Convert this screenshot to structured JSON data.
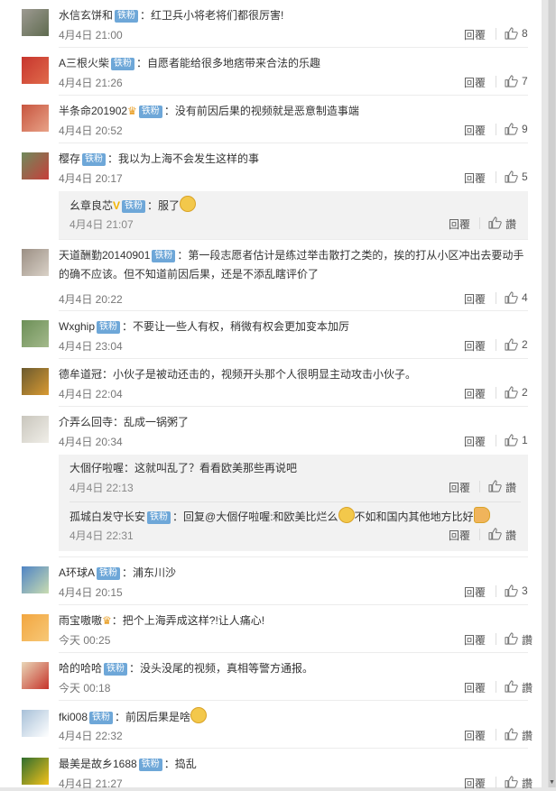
{
  "reply_label": "回覆",
  "like_placeholder": "讚",
  "badge_label": "铁粉",
  "colors": {
    "badge": "#6ea7d8",
    "page_bg": "#ffffff",
    "sub_bg": "#f2f2f2",
    "text": "#333333",
    "meta": "#777777"
  },
  "comments": [
    {
      "user": "水信玄饼和",
      "badge": true,
      "text": "：红卫兵小将老将们都很厉害!",
      "time": "4月4日 21:00",
      "likes": "8"
    },
    {
      "user": "A三根火柴",
      "badge": true,
      "text": "：自愿者能给很多地痞带来合法的乐趣",
      "time": "4月4日 21:26",
      "likes": "7"
    },
    {
      "user": "半条命201902",
      "crown": true,
      "badge": true,
      "text": "：没有前因后果的视频就是恶意制造事端",
      "time": "4月4日 20:52",
      "likes": "9"
    },
    {
      "user": "樱存",
      "badge": true,
      "text": "：我以为上海不会发生这样的事",
      "time": "4月4日 20:17",
      "likes": "5",
      "replies": [
        {
          "user": "幺章良芯",
          "verified": true,
          "badge": true,
          "text": "：服了",
          "emoji": true,
          "time": "4月4日 21:07"
        }
      ]
    },
    {
      "user": "天道酬勤20140901",
      "badge": true,
      "text": "：第一段志愿者估计是练过举击散打之类的，挨的打从小区冲出去要动手的确不应该。但不知道前因后果，还是不添乱瞎评价了",
      "time": "4月4日 20:22",
      "likes": "4"
    },
    {
      "user": "Wxghip",
      "badge": true,
      "text": "：不要让一些人有权，稍微有权会更加变本加厉",
      "time": "4月4日 23:04",
      "likes": "2"
    },
    {
      "user": "德牟道冠",
      "text": "：小伙子是被动还击的，视频开头那个人很明显主动攻击小伙子。",
      "time": "4月4日 22:04",
      "likes": "2"
    },
    {
      "user": "介弄么回寺",
      "text": "：乱成一锅粥了",
      "time": "4月4日 20:34",
      "likes": "1",
      "replies": [
        {
          "user": "大個仔啦喔",
          "text": "：这就叫乱了？看看欧美那些再说吧",
          "time": "4月4日 22:13"
        },
        {
          "user": "孤城白发守长安",
          "badge": true,
          "text": "：回复@大個仔啦喔:和欧美比烂么",
          "emoji": true,
          "text2": "不如和国内其他地方比好",
          "emoji2": true,
          "time": "4月4日 22:31"
        }
      ]
    },
    {
      "user": "A环球A",
      "badge": true,
      "text": "：浦东川沙",
      "time": "4月4日 20:15",
      "likes": "3"
    },
    {
      "user": "雨宝嗷嗷",
      "crown": true,
      "text": "：把个上海弄成这样?!让人痛心!",
      "time": "今天 00:25",
      "likes": "讚"
    },
    {
      "user": "哈的哈哈",
      "badge": true,
      "text": "：没头没尾的视频，真相等警方通报。",
      "time": "今天 00:18",
      "likes": "讚"
    },
    {
      "user": "fki008",
      "badge": true,
      "text": "：前因后果是啥",
      "emoji": true,
      "time": "4月4日 22:32",
      "likes": "讚"
    },
    {
      "user": "最美是故乡1688",
      "badge": true,
      "text": "：捣乱",
      "time": "4月4日 21:27",
      "likes": "讚"
    }
  ]
}
